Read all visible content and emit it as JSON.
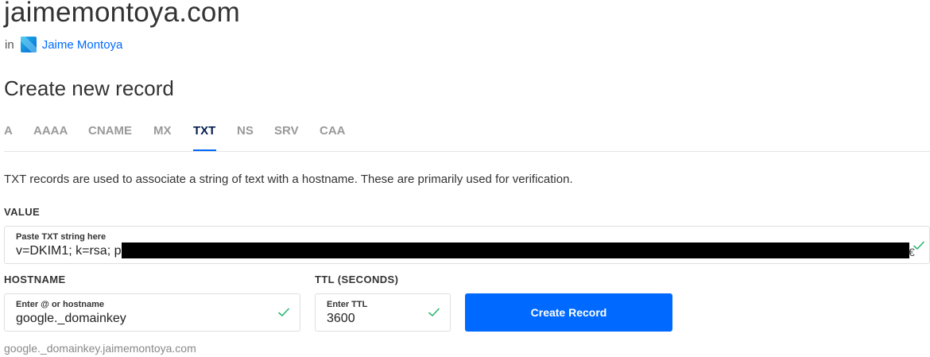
{
  "header": {
    "domain": "jaimemontoya.com",
    "in_label": "in",
    "project_name": "Jaime Montoya",
    "project_icon": "project-icon"
  },
  "section_title": "Create new record",
  "tabs": [
    {
      "label": "A",
      "active": false
    },
    {
      "label": "AAAA",
      "active": false
    },
    {
      "label": "CNAME",
      "active": false
    },
    {
      "label": "MX",
      "active": false
    },
    {
      "label": "TXT",
      "active": true
    },
    {
      "label": "NS",
      "active": false
    },
    {
      "label": "SRV",
      "active": false
    },
    {
      "label": "CAA",
      "active": false
    }
  ],
  "description": "TXT records are used to associate a string of text with a hostname. These are primarily used for verification.",
  "value": {
    "section_label": "VALUE",
    "field_label": "Paste TXT string here",
    "value_visible": "v=DKIM1; k=rsa; p=",
    "trailing_char": "€"
  },
  "hostname": {
    "section_label": "HOSTNAME",
    "field_label": "Enter @ or hostname",
    "value": "google._domainkey"
  },
  "ttl": {
    "section_label": "TTL (SECONDS)",
    "field_label": "Enter TTL",
    "value": "3600"
  },
  "submit_label": "Create Record",
  "fqdn_preview": "google._domainkey.jaimemontoya.com",
  "colors": {
    "accent": "#0069ff",
    "active_tab": "#031b4e",
    "valid_check": "#2bb673"
  }
}
